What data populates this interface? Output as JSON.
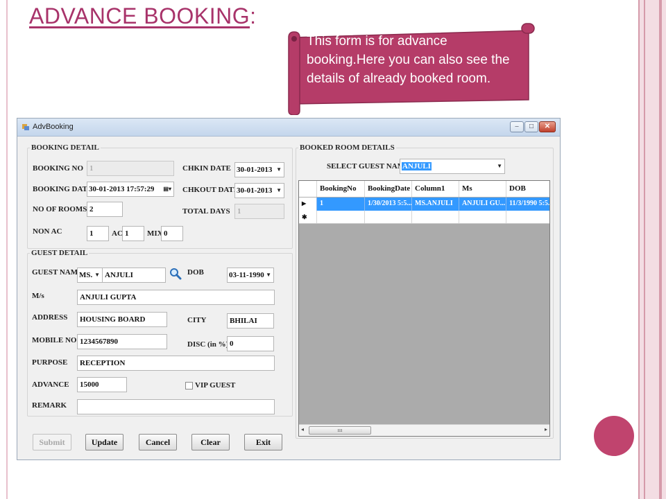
{
  "slide": {
    "title": "ADVANCE BOOKING",
    "title_colon": ":",
    "callout": "This form is for advance booking.Here you can also see the details of  already booked room."
  },
  "window": {
    "title": "AdvBooking",
    "minimize": "‒",
    "maximize": "□",
    "close": "✕"
  },
  "booking_detail": {
    "group_title": "BOOKING DETAIL",
    "booking_no_label": "BOOKING NO",
    "booking_no": "1",
    "booking_date_label": "BOOKING DATE",
    "booking_date": "30-01-2013 17:57:29",
    "no_of_rooms_label": "NO OF ROOMS",
    "no_of_rooms": "2",
    "non_ac_label": "NON AC",
    "non_ac": "1",
    "ac_label": "AC",
    "ac": "1",
    "mix_label": "MIX",
    "mix": "0",
    "chkin_label": "CHKIN DATE",
    "chkin": "30-01-2013",
    "chkout_label": "CHKOUT DATE",
    "chkout": "30-01-2013",
    "total_days_label": "TOTAL DAYS",
    "total_days": "1"
  },
  "guest_detail": {
    "group_title": "GUEST DETAIL",
    "guest_name_label": "GUEST NAME",
    "title_value": "MS.",
    "guest_name": "ANJULI",
    "dob_label": "DOB",
    "dob": "03-11-1990",
    "ms_label": "M/s",
    "ms": "ANJULI GUPTA",
    "address_label": "ADDRESS",
    "address": "HOUSING BOARD",
    "city_label": "CITY",
    "city": "BHILAI",
    "mobile_label": "MOBILE NO.",
    "mobile": "1234567890",
    "disc_label": "DISC (in %)",
    "disc": "0",
    "purpose_label": "PURPOSE",
    "purpose": "RECEPTION",
    "advance_label": "ADVANCE",
    "advance": "15000",
    "vip_label": "VIP GUEST",
    "vip_checked": false,
    "remark_label": "REMARK",
    "remark": ""
  },
  "booked_rooms": {
    "group_title": "BOOKED ROOM DETAILS",
    "select_label": "SELECT GUEST NAME",
    "selected_guest": "ANJULI",
    "columns": [
      "BookingNo",
      "BookingDate",
      "Column1",
      "Ms",
      "DOB"
    ],
    "rows": [
      [
        "1",
        "1/30/2013 5:5...",
        "MS.ANJULI",
        "ANJULI GU...",
        "11/3/1990 5:5..."
      ]
    ],
    "new_row_marker": "✱",
    "current_row_marker": "▶"
  },
  "buttons": {
    "submit": "Submit",
    "update": "Update",
    "cancel": "Cancel",
    "clear": "Clear",
    "exit": "Exit"
  },
  "colors": {
    "title_accent": "#a8336a",
    "callout_fill": "#b53c68",
    "selection_blue": "#3399ff"
  }
}
